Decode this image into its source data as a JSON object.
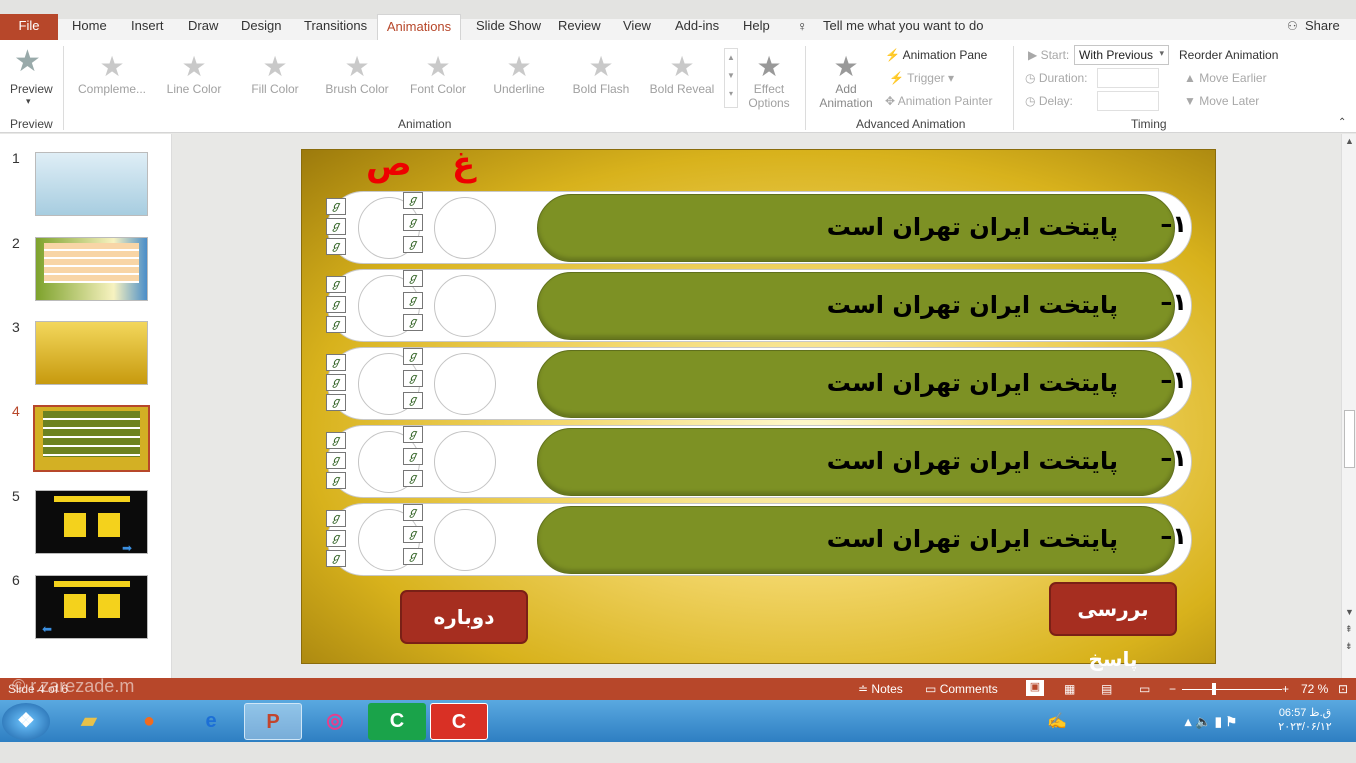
{
  "ribbon": {
    "tabs": [
      "Home",
      "Insert",
      "Draw",
      "Design",
      "Transitions",
      "Animations",
      "Slide Show",
      "Review",
      "View",
      "Add-ins",
      "Help"
    ],
    "file_label": "File",
    "tell_me": "Tell me what you want to do",
    "share": "Share",
    "preview_label": "Preview",
    "preview_group": "Preview",
    "effects": [
      "Compleme...",
      "Line Color",
      "Fill Color",
      "Brush Color",
      "Font Color",
      "Underline",
      "Bold Flash",
      "Bold Reveal"
    ],
    "effect_options": "Effect Options",
    "animation_group": "Animation",
    "add_animation": "Add Animation",
    "animation_pane": "Animation Pane",
    "trigger": "Trigger",
    "animation_painter": "Animation Painter",
    "advanced_group": "Advanced Animation",
    "start_label": "Start:",
    "start_value": "With Previous",
    "duration_label": "Duration:",
    "delay_label": "Delay:",
    "timing_group": "Timing",
    "reorder": "Reorder Animation",
    "move_earlier": "Move Earlier",
    "move_later": "Move Later"
  },
  "thumbnails": [
    "1",
    "2",
    "3",
    "4",
    "5",
    "6"
  ],
  "slide": {
    "header_letters": [
      "ص",
      "غ"
    ],
    "row_text": "پایتخت ایران تهران است",
    "row_number": "–۱",
    "check_glyph": "ℊ",
    "btn_check": "بررسی پاسخ",
    "btn_retry": "دوباره"
  },
  "status": {
    "slide_info": "Slide 4 of 6",
    "watermark": "© r.zarezade.m",
    "notes": "Notes",
    "comments": "Comments",
    "zoom": "72 %"
  },
  "taskbar": {
    "time": "06:57 ق.ظ",
    "date": "۲۰۲۳/۰۶/۱۲"
  }
}
